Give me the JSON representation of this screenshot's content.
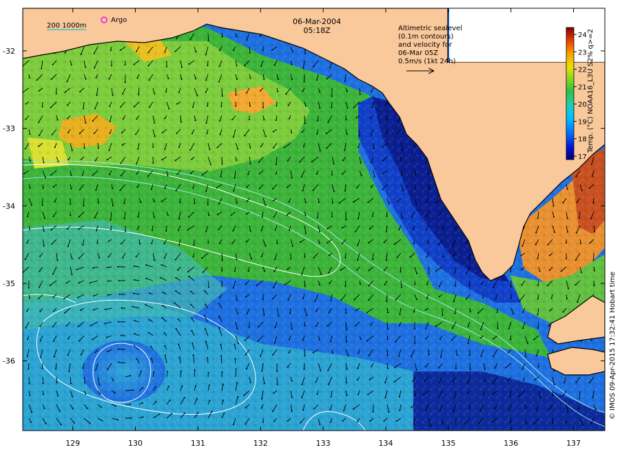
{
  "header": {
    "date": "06-Mar-2004",
    "time": "05:18Z"
  },
  "legend": {
    "isobaths": "200  1000m",
    "argo_label": "Argo"
  },
  "annotation": {
    "lines": [
      "Altimetric sealevel",
      "(0.1m contours)",
      "and velocity for",
      "06-Mar 05Z",
      "0.5m/s (1kt 24h)"
    ]
  },
  "colorbar": {
    "label": "Temp. (°C) NOAA16_L3U S2% q>=2",
    "ticks": [
      "24",
      "23",
      "22",
      "21",
      "20",
      "19",
      "18",
      "17"
    ],
    "colors": [
      "#000080",
      "#0000d0",
      "#0060ff",
      "#00b0ff",
      "#00e0c0",
      "#40d040",
      "#a0e020",
      "#e0e000",
      "#ffb000",
      "#ff6000",
      "#e02000",
      "#800000"
    ]
  },
  "credit": "© IMOS 09-Apr-2015 17:32:41 Hobart time",
  "colors": {
    "land": "#f9c89b",
    "warm": "#f6a532",
    "mid_green": "#36b43c",
    "light_green": "#a0dc3c",
    "cyan": "#2cb4d8",
    "blue": "#1464dc",
    "dark_blue": "#0a1c8c"
  },
  "chart_data": {
    "type": "map",
    "x_axis": {
      "ticks": [
        "129",
        "130",
        "131",
        "132",
        "133",
        "134",
        "135",
        "136",
        "137"
      ]
    },
    "y_axis": {
      "ticks": [
        "-32",
        "-33",
        "-34",
        "-35",
        "-36"
      ]
    },
    "xlim": [
      128.2,
      137.5
    ],
    "ylim": [
      -36.9,
      -31.45
    ],
    "colorbar_range_degC": [
      16.8,
      24.4
    ],
    "argo_marker": {
      "lon": 129.5,
      "lat": -31.6
    }
  }
}
